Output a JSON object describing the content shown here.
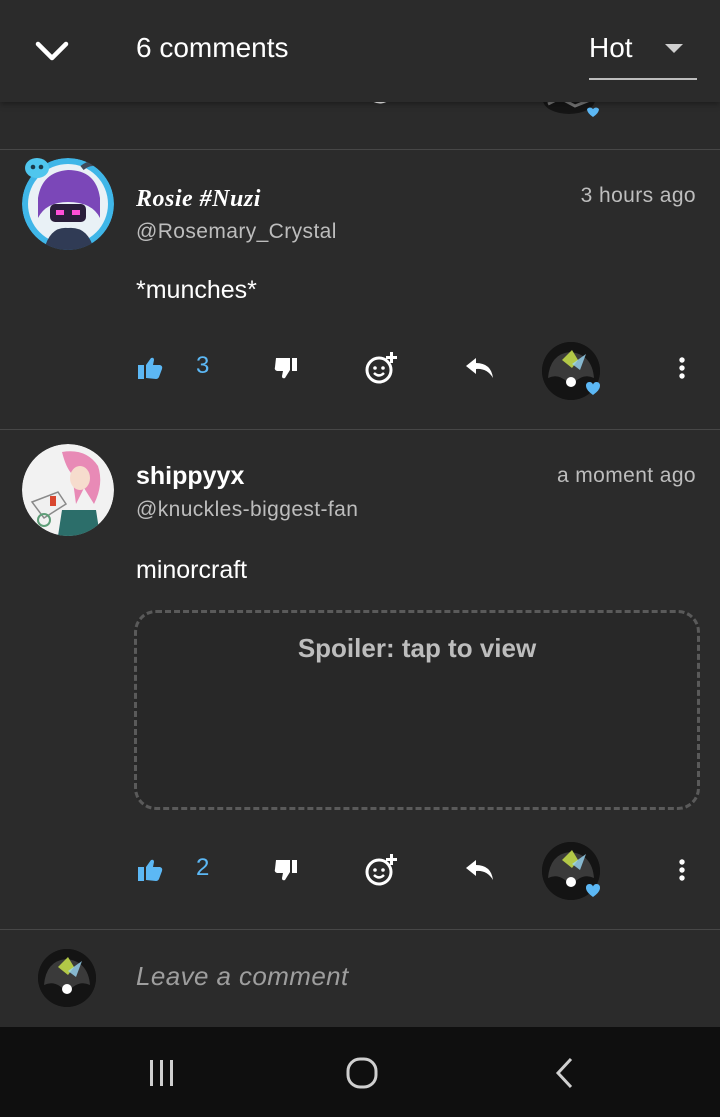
{
  "header": {
    "title": "6 comments",
    "sort_label": "Hot",
    "back_icon": "chevron-down-icon"
  },
  "comments": [
    {
      "display_name": "Rosie #Nuzi",
      "handle": "@Rosemary_Crystal",
      "time": "3 hours ago",
      "body": "*munches*",
      "likes": "3"
    },
    {
      "display_name": "shippyyx",
      "handle": "@knuckles-biggest-fan",
      "time": "a moment ago",
      "body": "minorcraft",
      "spoiler": "Spoiler: tap to view",
      "likes": "2"
    }
  ],
  "compose": {
    "placeholder": "Leave a comment"
  },
  "colors": {
    "accent": "#5cb8f5",
    "background": "#2b2b2b",
    "nav": "#0f0f0f"
  }
}
